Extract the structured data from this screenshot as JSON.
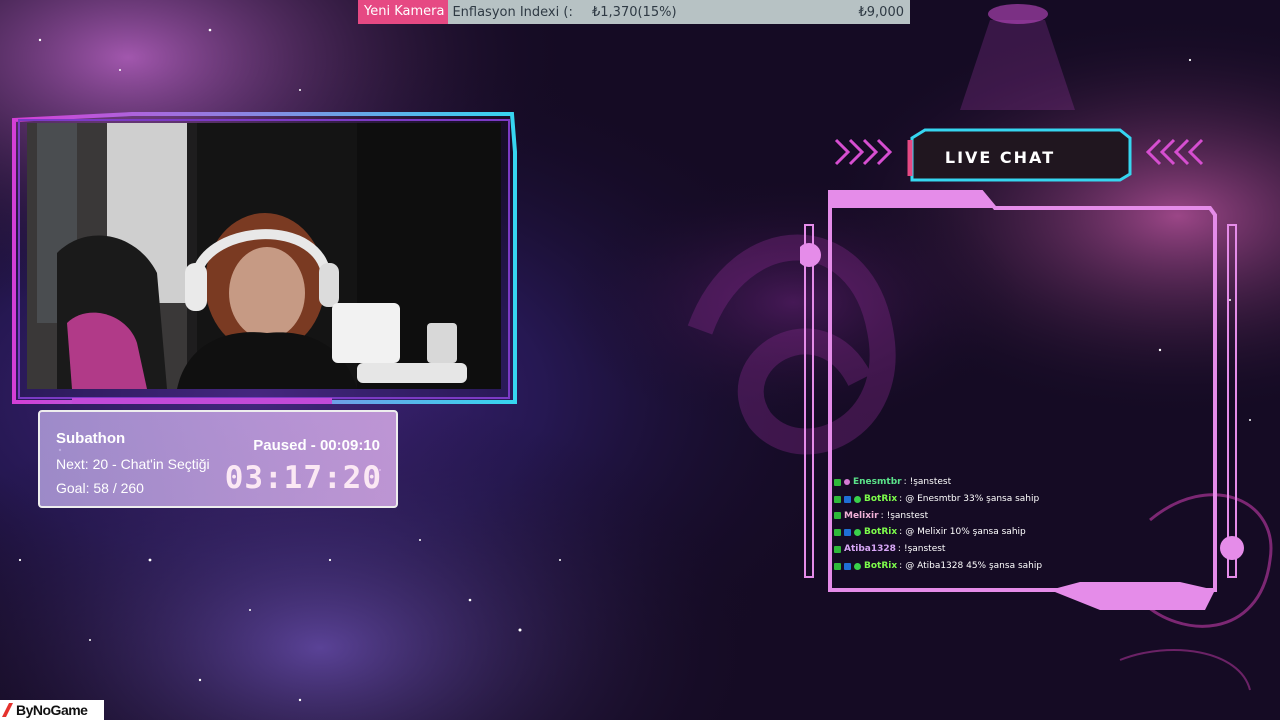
{
  "ticker": {
    "tag": "Yeni Kamera",
    "title": "Enflasyon Indexi (:",
    "amount": "₺1,370(15%)",
    "goal": "₺9,000"
  },
  "subathon": {
    "title": "Subathon",
    "next": "Next: 20 - Chat'in Seçtiği",
    "goal": "Goal: 58 / 260",
    "status": "Paused - 00:09:10",
    "timer": "03:17:20"
  },
  "chat": {
    "title": "LIVE CHAT",
    "messages": [
      {
        "user": "Enesmtbr",
        "text": "!şanstest",
        "color": "#5be38a",
        "badges": [
          "mod",
          "sub"
        ]
      },
      {
        "user": "BotRix",
        "text": "@ Enesmtbr 33% şansa sahip",
        "color": "#7dfc4b",
        "badges": [
          "mod",
          "bot",
          "verified"
        ]
      },
      {
        "user": "Melixir",
        "text": "!şanstest",
        "color": "#f2b2d8",
        "badges": [
          "mod"
        ]
      },
      {
        "user": "BotRix",
        "text": "@ Melixir 10% şansa sahip",
        "color": "#7dfc4b",
        "badges": [
          "mod",
          "bot",
          "verified"
        ]
      },
      {
        "user": "Atiba1328",
        "text": "!şanstest",
        "color": "#d7a6f5",
        "badges": [
          "mod"
        ]
      },
      {
        "user": "BotRix",
        "text": "@ Atiba1328 45% şansa sahip",
        "color": "#7dfc4b",
        "badges": [
          "mod",
          "bot",
          "verified"
        ]
      }
    ]
  },
  "logo": {
    "text": "ByNoGame"
  },
  "colors": {
    "accent_pink": "#e64983",
    "accent_cyan": "#36d6f0",
    "frame_pink": "#e58ce9"
  }
}
